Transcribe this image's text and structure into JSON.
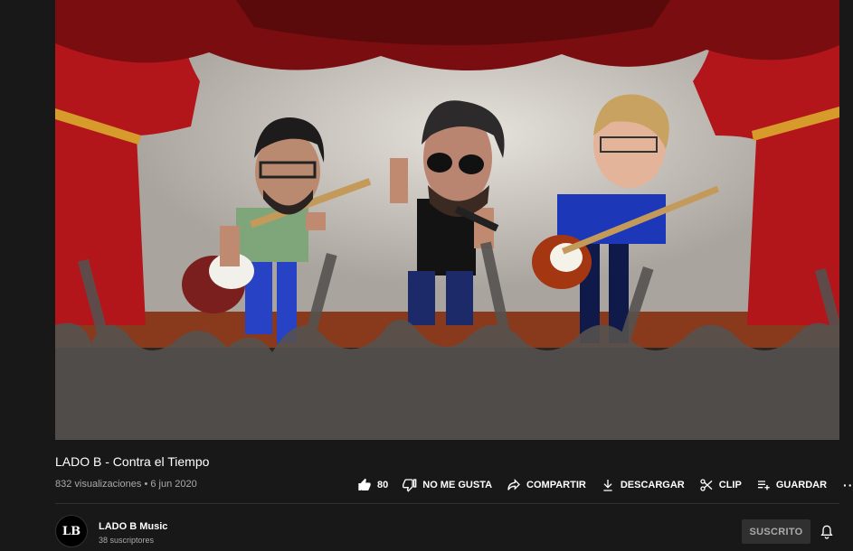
{
  "video": {
    "title": "LADO B - Contra el Tiempo",
    "views": "832 visualizaciones",
    "separator": "•",
    "date": "6 jun 2020",
    "thumbnail_description": "animated band performing on stage"
  },
  "actions": {
    "like_count": "80",
    "dislike_label": "NO ME GUSTA",
    "share_label": "COMPARTIR",
    "download_label": "DESCARGAR",
    "clip_label": "CLIP",
    "save_label": "GUARDAR",
    "more_label": "···"
  },
  "channel": {
    "avatar_text": "LB",
    "name": "LADO B Music",
    "subscribers": "38 suscriptores",
    "subscribed_label": "SUSCRITO"
  },
  "colors": {
    "background": "#181818",
    "text_secondary": "#aaaaaa",
    "subscribed_bg": "#303030",
    "curtain_red": "#b3161a"
  },
  "icons": [
    "thumb-up-icon",
    "thumb-down-icon",
    "share-icon",
    "download-icon",
    "scissors-icon",
    "playlist-add-icon",
    "bell-icon"
  ]
}
